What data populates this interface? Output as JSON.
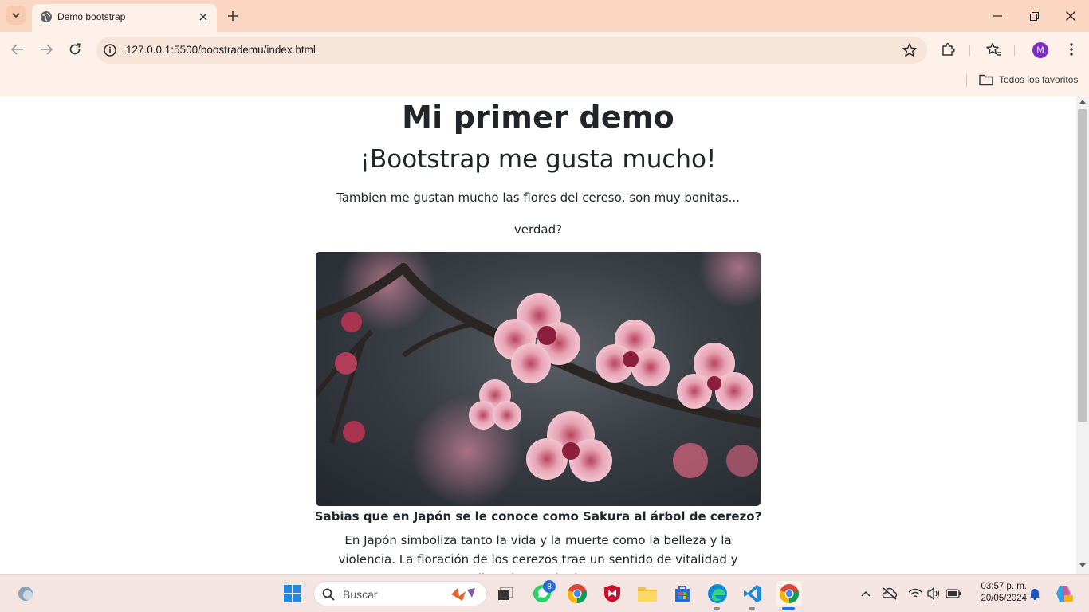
{
  "browser": {
    "tab_title": "Demo bootstrap",
    "url": "127.0.0.1:5500/boostrademu/index.html",
    "profile_initial": "M",
    "bookmarks_label": "Todos los favoritos"
  },
  "page": {
    "heading": "Mi primer demo",
    "subheading": "¡Bootstrap me gusta mucho!",
    "paragraph1": "Tambien me gustan mucho las flores del cereso, son muy bonitas...",
    "paragraph2": "verdad?",
    "image_subject": "cherry-blossom-photo",
    "caption_title": "Sabias que en Japón se le conoce como Sakura al árbol de cerezo?",
    "caption_body": "En Japón simboliza tanto la vida y la muerte como la belleza y la violencia. La floración de los cerezos trae un sentido de vitalidad y dinamismo. Al mismo"
  },
  "taskbar": {
    "search_label": "Buscar",
    "whatsapp_badge": "8",
    "time": "03:57 p. m.",
    "date": "20/05/2024"
  },
  "colors": {
    "tabstrip": "#fbd7c3",
    "toolbar": "#fdf1ea",
    "text": "#212529",
    "taskbar": "#f5e5e2"
  }
}
